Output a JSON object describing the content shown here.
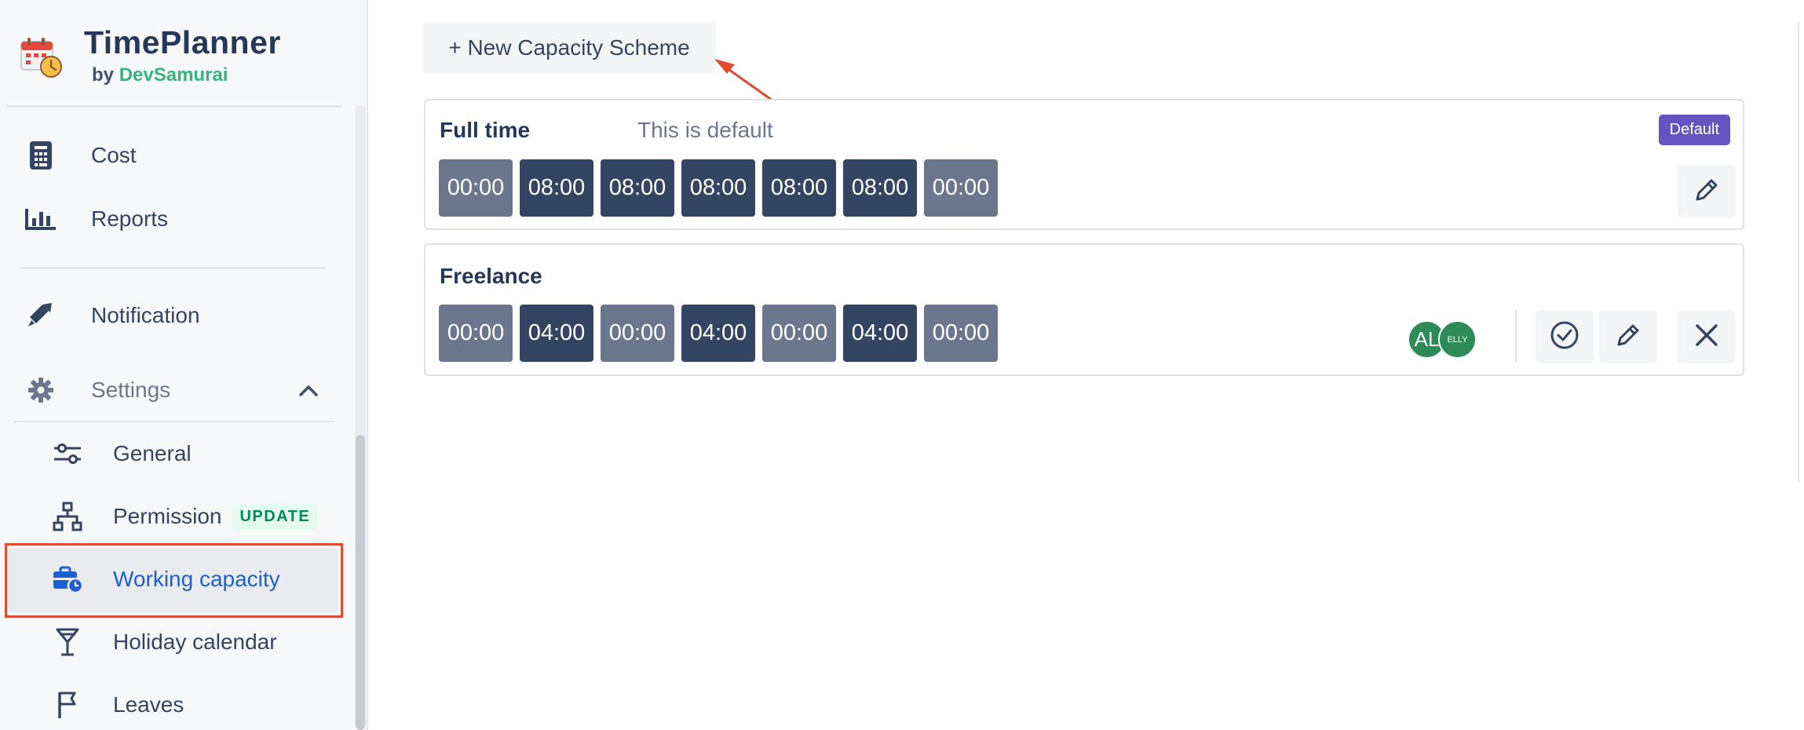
{
  "brand": {
    "title": "TimePlanner",
    "by": "by",
    "company": "DevSamurai"
  },
  "nav": {
    "cost": "Cost",
    "reports": "Reports",
    "notification": "Notification",
    "settings": "Settings",
    "general": "General",
    "permission": "Permission",
    "permission_badge": "UPDATE",
    "working_capacity": "Working capacity",
    "holiday_calendar": "Holiday calendar",
    "leaves": "Leaves"
  },
  "main": {
    "new_scheme_button": "+ New Capacity Scheme",
    "schemes": [
      {
        "name": "Full time",
        "description": "This is default",
        "badge": "Default",
        "hours": [
          "00:00",
          "08:00",
          "08:00",
          "08:00",
          "08:00",
          "08:00",
          "00:00"
        ]
      },
      {
        "name": "Freelance",
        "hours": [
          "00:00",
          "04:00",
          "00:00",
          "04:00",
          "00:00",
          "04:00",
          "00:00"
        ],
        "avatars": [
          "AL",
          "ELLY"
        ]
      }
    ]
  },
  "colors": {
    "active_link": "#1d5fd1",
    "highlight_outline": "#e04a2f",
    "default_badge": "#6554c0",
    "hour_working": "#344563",
    "hour_off": "#6b778c",
    "avatar": "#2e8b57"
  }
}
